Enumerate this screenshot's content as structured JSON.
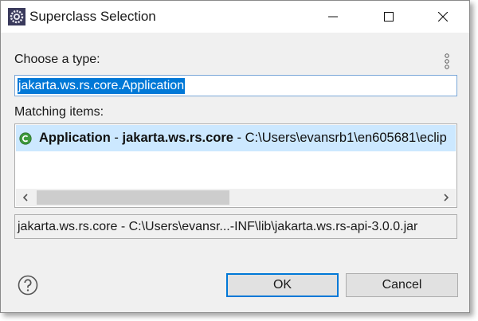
{
  "window": {
    "title": "Superclass Selection",
    "icon": "eclipse-gear-icon",
    "controls": [
      "minimize-icon",
      "maximize-icon",
      "close-icon"
    ]
  },
  "search": {
    "label": "Choose a type:",
    "value": "jakarta.ws.rs.core.Application"
  },
  "matching": {
    "label": "Matching items:",
    "items": [
      {
        "icon": "class-icon",
        "name": "Application",
        "sep1": " - ",
        "package": "jakarta.ws.rs.core",
        "sep2": " - ",
        "path": "C:\\Users\\evansrb1\\en605681\\eclip"
      }
    ]
  },
  "details": {
    "text": "jakarta.ws.rs.core - C:\\Users\\evansr...-INF\\lib\\jakarta.ws.rs-api-3.0.0.jar"
  },
  "buttons": {
    "ok": "OK",
    "cancel": "Cancel"
  },
  "colors": {
    "selection": "#0078d7",
    "row_highlight": "#cce8ff",
    "class_icon": "#3f9a3c"
  }
}
